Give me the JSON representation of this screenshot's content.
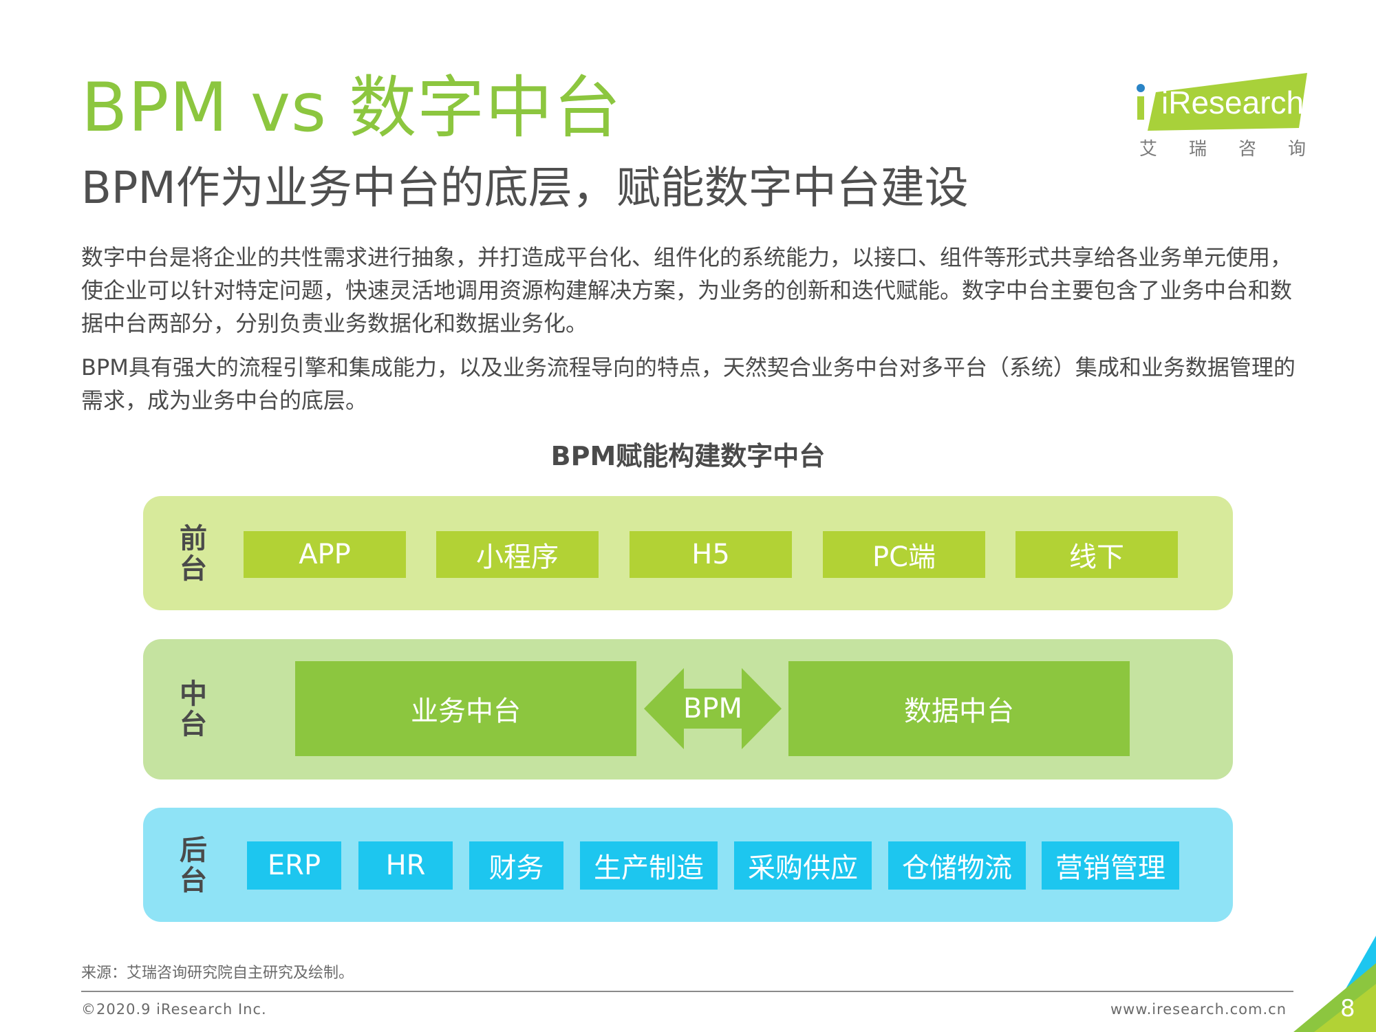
{
  "header": {
    "title": "BPM vs 数字中台",
    "subtitle": "BPM作为业务中台的底层，赋能数字中台建设"
  },
  "logo": {
    "brand": "iResearch",
    "cn": "艾瑞咨询",
    "colors": {
      "green": "#a8d13a",
      "blue": "#2a84c6"
    }
  },
  "body": {
    "paragraph1": "数字中台是将企业的共性需求进行抽象，并打造成平台化、组件化的系统能力，以接口、组件等形式共享给各业务单元使用，使企业可以针对特定问题，快速灵活地调用资源构建解决方案，为业务的创新和迭代赋能。数字中台主要包含了业务中台和数据中台两部分，分别负责业务数据化和数据业务化。",
    "paragraph2": "BPM具有强大的流程引擎和集成能力，以及业务流程导向的特点，天然契合业务中台对多平台（系统）集成和业务数据管理的需求，成为业务中台的底层。"
  },
  "diagram": {
    "title": "BPM赋能构建数字中台",
    "front": {
      "label": "前台",
      "items": [
        "APP",
        "小程序",
        "H5",
        "PC端",
        "线下"
      ]
    },
    "middle": {
      "label": "中台",
      "left": "业务中台",
      "connector": "BPM",
      "right": "数据中台"
    },
    "back": {
      "label": "后台",
      "items": [
        "ERP",
        "HR",
        "财务",
        "生产制造",
        "采购供应",
        "仓储物流",
        "营销管理"
      ]
    },
    "colors": {
      "front_band": "#d7ea9b",
      "front_box": "#b2d235",
      "middle_band": "#c5e3a0",
      "middle_box": "#8cc63f",
      "back_band": "#8fe3f6",
      "back_box": "#1dc6ef"
    }
  },
  "footer": {
    "source": "来源：艾瑞咨询研究院自主研究及绘制。",
    "copyright": "©2020.9 iResearch Inc.",
    "website": "www.iresearch.com.cn",
    "page_number": "8"
  }
}
